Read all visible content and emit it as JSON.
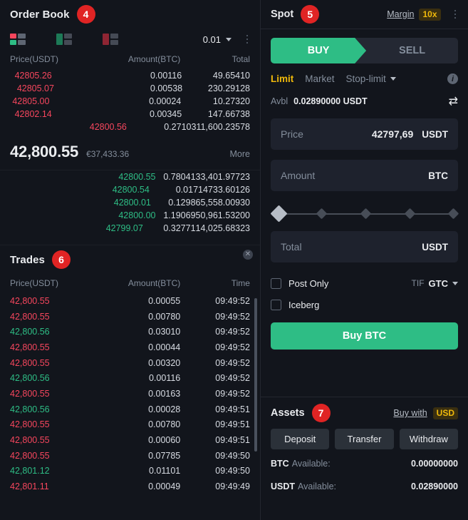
{
  "order_book": {
    "title": "Order Book",
    "badge": "4",
    "tick_size": "0.01",
    "columns": {
      "price": "Price(USDT)",
      "amount": "Amount(BTC)",
      "total": "Total"
    },
    "view_modes": [
      "both-view-icon",
      "bids-view-icon",
      "asks-view-icon"
    ],
    "asks": [
      {
        "price": "42805.26",
        "amount": "0.00116",
        "total": "49.65410",
        "depth": 2
      },
      {
        "price": "42805.07",
        "amount": "0.00538",
        "total": "230.29128",
        "depth": 3
      },
      {
        "price": "42805.00",
        "amount": "0.00024",
        "total": "10.27320",
        "depth": 1
      },
      {
        "price": "42802.14",
        "amount": "0.00345",
        "total": "147.66738",
        "depth": 2
      },
      {
        "price": "42800.56",
        "amount": "0.27103",
        "total": "11,600.23578",
        "depth": 53
      }
    ],
    "mid": {
      "price": "42,800.55",
      "fiat": "€37,433.36",
      "more_label": "More"
    },
    "bids": [
      {
        "price": "42800.55",
        "amount": "0.78041",
        "total": "33,401.97723",
        "depth": 100
      },
      {
        "price": "42800.54",
        "amount": "0.01714",
        "total": "733.60126",
        "depth": 76
      },
      {
        "price": "42800.01",
        "amount": "0.12986",
        "total": "5,558.00930",
        "depth": 85
      },
      {
        "price": "42800.00",
        "amount": "1.19069",
        "total": "50,961.53200",
        "depth": 100
      },
      {
        "price": "42799.07",
        "amount": "0.32771",
        "total": "14,025.68323",
        "depth": 76
      }
    ]
  },
  "trades": {
    "title": "Trades",
    "badge": "6",
    "columns": {
      "price": "Price(USDT)",
      "amount": "Amount(BTC)",
      "time": "Time"
    },
    "rows": [
      {
        "price": "42,800.55",
        "amount": "0.00055",
        "time": "09:49:52",
        "side": "down"
      },
      {
        "price": "42,800.55",
        "amount": "0.00780",
        "time": "09:49:52",
        "side": "down"
      },
      {
        "price": "42,800.56",
        "amount": "0.03010",
        "time": "09:49:52",
        "side": "up"
      },
      {
        "price": "42,800.55",
        "amount": "0.00044",
        "time": "09:49:52",
        "side": "down"
      },
      {
        "price": "42,800.55",
        "amount": "0.00320",
        "time": "09:49:52",
        "side": "down"
      },
      {
        "price": "42,800.56",
        "amount": "0.00116",
        "time": "09:49:52",
        "side": "up"
      },
      {
        "price": "42,800.55",
        "amount": "0.00163",
        "time": "09:49:52",
        "side": "down"
      },
      {
        "price": "42,800.56",
        "amount": "0.00028",
        "time": "09:49:51",
        "side": "up"
      },
      {
        "price": "42,800.55",
        "amount": "0.00780",
        "time": "09:49:51",
        "side": "down"
      },
      {
        "price": "42,800.55",
        "amount": "0.00060",
        "time": "09:49:51",
        "side": "down"
      },
      {
        "price": "42,800.55",
        "amount": "0.07785",
        "time": "09:49:50",
        "side": "down"
      },
      {
        "price": "42,801.12",
        "amount": "0.01101",
        "time": "09:49:50",
        "side": "up"
      },
      {
        "price": "42,801.11",
        "amount": "0.00049",
        "time": "09:49:49",
        "side": "down"
      }
    ]
  },
  "spot": {
    "title": "Spot",
    "badge": "5",
    "margin_label": "Margin",
    "leverage": "10x",
    "buy_label": "BUY",
    "sell_label": "SELL",
    "order_types": [
      {
        "label": "Limit",
        "active": true
      },
      {
        "label": "Market",
        "active": false
      },
      {
        "label": "Stop-limit",
        "active": false
      }
    ],
    "avbl_label": "Avbl",
    "avbl_value": "0.02890000 USDT",
    "price_field": {
      "label": "Price",
      "value": "42797,69",
      "unit": "USDT"
    },
    "amount_field": {
      "label": "Amount",
      "value": "",
      "unit": "BTC"
    },
    "total_field": {
      "label": "Total",
      "value": "",
      "unit": "USDT"
    },
    "slider_percent": 0,
    "post_only_label": "Post Only",
    "iceberg_label": "Iceberg",
    "tif_label": "TIF",
    "tif_value": "GTC",
    "submit_label": "Buy BTC"
  },
  "assets": {
    "title": "Assets",
    "badge": "7",
    "buy_with_label": "Buy with",
    "currency": "USD",
    "buttons": [
      "Deposit",
      "Transfer",
      "Withdraw"
    ],
    "balances": [
      {
        "symbol": "BTC",
        "label": "Available:",
        "value": "0.00000000"
      },
      {
        "symbol": "USDT",
        "label": "Available:",
        "value": "0.02890000"
      }
    ]
  },
  "colors": {
    "up": "#2ebd85",
    "down": "#f6465d",
    "accent": "#f0b90b",
    "badge": "#e02424"
  }
}
